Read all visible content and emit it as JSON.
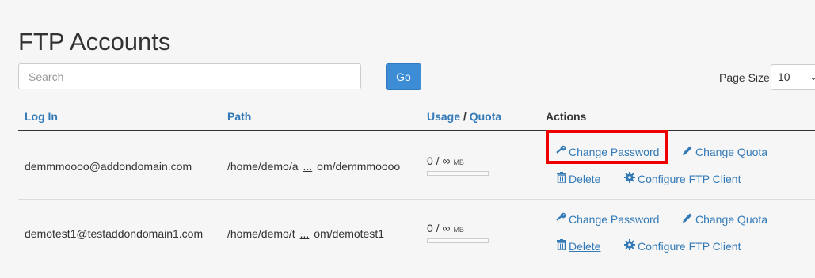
{
  "page": {
    "title": "FTP Accounts"
  },
  "search": {
    "placeholder": "Search",
    "value": "",
    "go_label": "Go"
  },
  "page_size": {
    "label": "Page Size",
    "value": "10"
  },
  "table": {
    "headers": {
      "login": "Log In",
      "path": "Path",
      "usage": "Usage",
      "separator": "/",
      "quota": "Quota",
      "actions": "Actions"
    },
    "rows": [
      {
        "login": "demmmoooo@addondomain.com",
        "path_start": "/home/demo/a",
        "path_ellipsis": "...",
        "path_end": "om/demmmoooo",
        "usage": "0 / ∞",
        "unit": "MB",
        "usage_fraction": 0
      },
      {
        "login": "demotest1@testaddondomain1.com",
        "path_start": "/home/demo/t",
        "path_ellipsis": "...",
        "path_end": "om/demotest1",
        "usage": "0 / ∞",
        "unit": "MB",
        "usage_fraction": 0
      }
    ],
    "actions": {
      "change_password": "Change Password",
      "change_quota": "Change Quota",
      "delete": "Delete",
      "configure_ftp_client": "Configure FTP Client"
    }
  },
  "icons": {
    "key": "key-icon",
    "pencil": "pencil-icon",
    "trash": "trash-icon",
    "gear": "gear-icon",
    "chevron": "chevron-down-icon"
  },
  "colors": {
    "link": "#337ab7",
    "button": "#3c8dd6",
    "highlight": "#ee0000"
  }
}
